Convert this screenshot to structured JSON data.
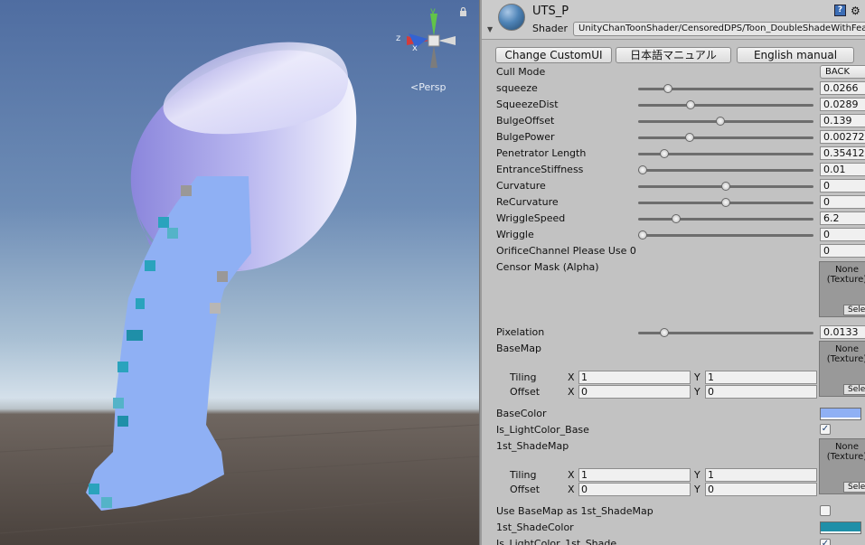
{
  "scene": {
    "persp_label": "Persp",
    "gizmo": {
      "x_label": "x",
      "y_label": "y",
      "z_label": "z"
    }
  },
  "header": {
    "material_name": "UTS_P",
    "shader_label": "Shader",
    "shader_value": "UnityChanToonShader/CensoredDPS/Toon_DoubleShadeWithFeather"
  },
  "buttons": {
    "change_custom_ui": "Change CustomUI",
    "japanese_manual": "日本語マニュアル",
    "english_manual": "English manual"
  },
  "properties": {
    "cull_mode": {
      "label": "Cull Mode",
      "value": "BACK"
    },
    "squeeze": {
      "label": "squeeze",
      "value": "0.0266",
      "level": 0.15
    },
    "squeeze_dist": {
      "label": "SqueezeDist",
      "value": "0.0289",
      "level": 0.29
    },
    "bulge_offset": {
      "label": "BulgeOffset",
      "value": "0.139",
      "level": 0.47
    },
    "bulge_power": {
      "label": "BulgePower",
      "value": "0.00272",
      "level": 0.28
    },
    "penetrator_length": {
      "label": "Penetrator Length",
      "value": "0.35412",
      "level": 0.13
    },
    "entrance_stiffness": {
      "label": "EntranceStiffness",
      "value": "0.01",
      "level": 0.0
    },
    "curvature": {
      "label": "Curvature",
      "value": "0",
      "level": 0.5
    },
    "re_curvature": {
      "label": "ReCurvature",
      "value": "0",
      "level": 0.5
    },
    "wriggle_speed": {
      "label": "WriggleSpeed",
      "value": "6.2",
      "level": 0.2
    },
    "wriggle": {
      "label": "Wriggle",
      "value": "0",
      "level": 0.0
    },
    "orifice_channel": {
      "label": "OrificeChannel Please Use 0",
      "value": "0"
    },
    "censor_mask": {
      "label": "Censor Mask (Alpha)",
      "tex_none": "None",
      "tex_type": "(Texture)",
      "select": "Select"
    },
    "pixelation": {
      "label": "Pixelation",
      "value": "0.0133",
      "level": 0.13
    },
    "base_map": {
      "label": "BaseMap",
      "tex_none": "None",
      "tex_type": "(Texture)",
      "select": "Select",
      "tiling_label": "Tiling",
      "offset_label": "Offset",
      "tiling_x": "1",
      "tiling_y": "1",
      "offset_x": "0",
      "offset_y": "0"
    },
    "base_color": {
      "label": "BaseColor",
      "color": "#8fb0f4"
    },
    "is_light_color_base": {
      "label": "Is_LightColor_Base",
      "checked": true
    },
    "first_shade_map": {
      "label": "1st_ShadeMap",
      "tex_none": "None",
      "tex_type": "(Texture)",
      "select": "Select",
      "tiling_label": "Tiling",
      "offset_label": "Offset",
      "tiling_x": "1",
      "tiling_y": "1",
      "offset_x": "0",
      "offset_y": "0"
    },
    "use_basemap_as_1st": {
      "label": "Use BaseMap as 1st_ShadeMap",
      "checked": false
    },
    "first_shade_color": {
      "label": "1st_ShadeColor",
      "color": "#1f8fa8"
    },
    "is_light_color_1st_shade": {
      "label": "Is_LightColor_1st_Shade",
      "checked": true
    }
  },
  "axis_labels": {
    "x": "X",
    "y": "Y"
  },
  "colors": {
    "model_light": "#8fb0f4",
    "model_teal": "#2aa3bd",
    "cap_lavender": "#aeaaea"
  }
}
